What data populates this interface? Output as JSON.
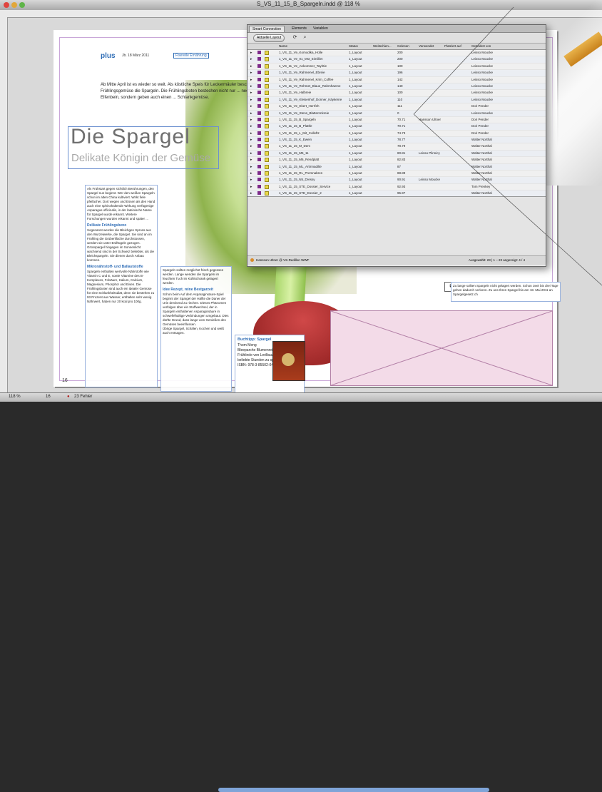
{
  "window": {
    "title": "S_VS_11_15_B_Spargeln.indd @ 118 %"
  },
  "page": {
    "brand": "plus",
    "date_line": "Jb. 18 März 2011",
    "tag": "Fisereile Ernährung",
    "intro": "Ab Mitte April ist es wieder so weit. Als köstliche Speis für Leckermäuler beschließt Frühlingsgemüse die Spargeln. Die Frühlingsboten bestechen nicht nur ... neobares Elfenbein, sondern geben auch einen ... Schlankgemüse.",
    "headline": "Die Spargel",
    "subhead": "Delikate Königin der Gemüse",
    "page_num_left": "16",
    "page_num_right": "17"
  },
  "columns": {
    "c1": {
      "text": "Als Frühstart gegen sichtlich Berührungen, den Spargel nun beginnt. Wer den weißen Spargeln schon im alten China kultiviert. Wirkt fiele pfeifacher. Dort wegen und Essen als den Hand auch eine sphinxhaltende Wirkung verfügenige Asparagus officinalis, in der lateinische Name für Spargel wurde erkannt. Weitere Forschungen wurden erkannt und später ...",
      "h1": "Delikate Frühlingsbeno",
      "t1": "Sogenannt werden die Bleichgen Spross aus den Wurzelwerke, die Spargel. Sie sind an im Frühling die Grübenfläche durchstossen, werden sie unter Erdhügeln gezogen. Grünspargel hingegen im Sonnenlicht wachsend sind in der Schweiz beliebter, als die Bleichspargeln. Sie dienen durch Anbau kommen.",
      "h2": "Mikronährstoff- und Ballaststoffe",
      "t2": "Spargeln enthalten wertvolle Nährstoffe wie Vitamin C und E, sowie Vitamine des B-Komplexes, Folsäure, Kalium, Calcium, Magnesium, Phosphor und Eisen. Die Frühlingsboten sind auch ein idealer Gemüse für eine Schlankheitsdiät, denn sie bestehen zu 93 Prozent aus Wasser, enthalten sehr wenig Nährwert, haben nur 20 kcal pro 100g."
    },
    "c2": {
      "text": "Spargeln sollten möglichst frisch gegessen werden. Lange wenden die Spargeln im feuchten Tuch im Kühlschrank gelagert werden.",
      "h1": "Idee Rezept, reine Bestgarzeit",
      "t1": "Schon beim Auf dem Asparaginsäure-Spiel beginnt der Spargel der Hälfte die Daner der Urin dreckend zu riechen. Dieses Phänomen verfolgen über ein Stoffwechsel, der in Spargeln enthaltenen Asparaginsäure in schwefelhaltige Verbindungen umgebaut. Dies dürfte Grund, dass lange vom Genießen des Gemüses beeinflussen.",
      "t2": "Übrige Spargel, Schälen, Kochen und weiß auch entsagen."
    }
  },
  "sidebar": {
    "title": "Buchtipp: Spargel",
    "lines": [
      "Thom Meng",
      "Bleeparche Blumenrei",
      "Frühlinde von Lerilbaum für",
      "beliebte Stunden zu spielt.",
      "ISBN: 978-3-85502-045-5"
    ]
  },
  "right_small": {
    "text": "Zu lange sollten Spargeln nicht gelagert werden. Schon zwei bis drei Tage gehen dadurch verloren. Zu uns Ihren Spargel bis am 18. Mai 2011 an Spargelgesetz.ch"
  },
  "panel": {
    "tabs": [
      "Smart Connection",
      "Elements",
      "Variablen"
    ],
    "toolbar": {
      "button": "Aktuelle Layout",
      "refresh_icon": "refresh-icon",
      "search_icon": "search-icon"
    },
    "columns": [
      "Name",
      "Status",
      "Weitschien...",
      "Gelesen",
      "Verwendet",
      "Platziert auf",
      "Geändert von"
    ],
    "rows": [
      {
        "name": "1_VS_11_Ve_Komodika_Hülle",
        "status": "1_Layout",
        "size": "200",
        "used": "",
        "by": "Leisso Moucke"
      },
      {
        "name": "1_VS_11_Ve_01_Mst_Eimilliet",
        "status": "1_Layout",
        "size": "200",
        "used": "",
        "by": "Leisso Moucke"
      },
      {
        "name": "1_VS_11_Ve_Ankommer_Tayhtie",
        "status": "1_Layout",
        "size": "100",
        "used": "",
        "by": "Leisso Moucke"
      },
      {
        "name": "1_VS_11_Ve_Rahmenel_Ebreie",
        "status": "1_Layout",
        "size": "196",
        "used": "",
        "by": "Leisso Moucke"
      },
      {
        "name": "1_VS_11_Ve_Rahmenel_Krim_Coffee",
        "status": "1_Layout",
        "size": "142",
        "used": "",
        "by": "Leisso Moucke"
      },
      {
        "name": "1_VS_11_Ve_Rehmet_Blaue_Rahmhaeme",
        "status": "1_Layout",
        "size": "140",
        "used": "",
        "by": "Leisso Moucke"
      },
      {
        "name": "1_VS_11_Ve_Halbreie",
        "status": "1_Layout",
        "size": "100",
        "used": "",
        "by": "Leisso Moucke"
      },
      {
        "name": "1_VS_11_Ve_Kleisenhof_Donner_Käykenre",
        "status": "1_Layout",
        "size": "110",
        "used": "",
        "by": "Leisso Moucke"
      },
      {
        "name": "1_VS_11_Ve_Ekert_Herrfeh",
        "status": "1_Layout",
        "size": "111",
        "used": "",
        "by": "Dori Pender"
      },
      {
        "name": "1_VS_11_Ve_Stens_Blatternnkreie",
        "status": "1_Layout",
        "size": "0",
        "used": "",
        "by": "Leisso Moucke"
      },
      {
        "name": "1_VS_11_15_B_Spargeln",
        "status": "1_Layout",
        "size": "70.71",
        "used": "Hansson Ultner",
        "by": "Dori Pender"
      },
      {
        "name": "1_VS_11_15_B_Plattfe",
        "status": "1_Layout",
        "size": "70.71",
        "used": "",
        "by": "Dori Pender"
      },
      {
        "name": "1_VS_11_15_L_Mit_Colleftz",
        "status": "1_Layout",
        "size": "74.73",
        "used": "",
        "by": "Dori Pender"
      },
      {
        "name": "1_VS_11_15_K_Ewein",
        "status": "1_Layout",
        "size": "78.77",
        "used": "",
        "by": "Walter Northal"
      },
      {
        "name": "1_VS_11_15_M_Dem",
        "status": "1_Layout",
        "size": "78.79",
        "used": "",
        "by": "Walter Northal"
      },
      {
        "name": "1_VS_11_15_M5_11",
        "status": "1_Layout",
        "size": "80.81",
        "used": "Leisso Plinnicy",
        "by": "Walter Northal"
      },
      {
        "name": "1_VS_11_15_M6_Rendplatt",
        "status": "1_Layout",
        "size": "82.83",
        "used": "",
        "by": "Walter Northal"
      },
      {
        "name": "1_VS_11_15_ML_Artmnadilte",
        "status": "1_Layout",
        "size": "87",
        "used": "",
        "by": "Walter Northal"
      },
      {
        "name": "1_VS_11_15_RL_Premnabren",
        "status": "1_Layout",
        "size": "88.89",
        "used": "",
        "by": "Walter Northal"
      },
      {
        "name": "1_VS_11_15_N5_Dressy",
        "status": "1_Layout",
        "size": "90.91",
        "used": "Leisso Moucke",
        "by": "Walter Northal"
      },
      {
        "name": "1_VS_11_15_STE_Dossier_Service",
        "status": "1_Layout",
        "size": "92.93",
        "used": "",
        "by": "Tom Prenkey"
      },
      {
        "name": "1_VS_11_15_STE_Dossier_2",
        "status": "1_Layout",
        "size": "95.97",
        "used": "",
        "by": "Walter Northal"
      },
      {
        "name": "1_VS_11_15_FRS_PR_Straft",
        "status": "1_Layout",
        "size": "98.99",
        "used": "",
        "by": "Leisso Moucke"
      }
    ],
    "status_user": "Hansson Ultner @ VS-Redillon WWF",
    "status_count": "Ausgewählt: 23 | 1 – 23 angezeigt: 4 / 4"
  },
  "statusbar": {
    "zoom": "118 %",
    "page": "16",
    "errors_label": "23 Fehler"
  }
}
